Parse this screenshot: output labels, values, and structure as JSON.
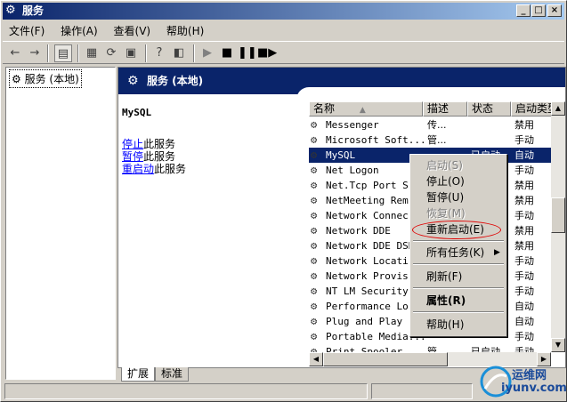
{
  "window": {
    "title": "服务",
    "min": "_",
    "max": "□",
    "close": "×"
  },
  "menu": [
    "文件(F)",
    "操作(A)",
    "查看(V)",
    "帮助(H)"
  ],
  "tree": {
    "root": "服务 (本地)"
  },
  "panel": {
    "header": "服务 (本地)"
  },
  "detail": {
    "service": "MySQL",
    "stop_link": "停止",
    "stop_suffix": "此服务",
    "pause_link": "暂停",
    "pause_suffix": "此服务",
    "restart_link": "重启动",
    "restart_suffix": "此服务"
  },
  "columns": {
    "name": "名称",
    "desc": "描述",
    "status": "状态",
    "startup": "启动类型"
  },
  "rows": [
    {
      "name": "Messenger",
      "desc": "传...",
      "status": "",
      "startup": "禁用"
    },
    {
      "name": "Microsoft Soft...",
      "desc": "管...",
      "status": "",
      "startup": "手动"
    },
    {
      "name": "MySQL",
      "desc": "",
      "status": "已启动",
      "startup": "自动"
    },
    {
      "name": "Net Logon",
      "desc": "",
      "status": "",
      "startup": "手动"
    },
    {
      "name": "Net.Tcp Port S...",
      "desc": "",
      "status": "",
      "startup": "禁用"
    },
    {
      "name": "NetMeeting Rem...",
      "desc": "",
      "status": "",
      "startup": "禁用"
    },
    {
      "name": "Network Connec...",
      "desc": "",
      "status": "",
      "startup": "手动"
    },
    {
      "name": "Network DDE",
      "desc": "",
      "status": "",
      "startup": "禁用"
    },
    {
      "name": "Network DDE DSDM",
      "desc": "",
      "status": "",
      "startup": "禁用"
    },
    {
      "name": "Network Locati...",
      "desc": "",
      "status": "",
      "startup": "手动"
    },
    {
      "name": "Network Provis...",
      "desc": "",
      "status": "",
      "startup": "手动"
    },
    {
      "name": "NT LM Security...",
      "desc": "",
      "status": "",
      "startup": "手动"
    },
    {
      "name": "Performance Lo...",
      "desc": "",
      "status": "",
      "startup": "自动"
    },
    {
      "name": "Plug and Play",
      "desc": "",
      "status": "",
      "startup": "自动"
    },
    {
      "name": "Portable Media...",
      "desc": "",
      "status": "",
      "startup": "手动"
    },
    {
      "name": "Print Spooler",
      "desc": "管...",
      "status": "已启动",
      "startup": "手动"
    }
  ],
  "context_menu": {
    "start": "启动(S)",
    "stop": "停止(O)",
    "pause": "暂停(U)",
    "resume": "恢复(M)",
    "restart": "重新启动(E)",
    "all_tasks": "所有任务(K)",
    "refresh": "刷新(F)",
    "properties": "属性(R)",
    "help": "帮助(H)"
  },
  "tabs": [
    "扩展",
    "标准"
  ],
  "watermark": {
    "line1": "运维网",
    "line2": "iyunv.com"
  }
}
